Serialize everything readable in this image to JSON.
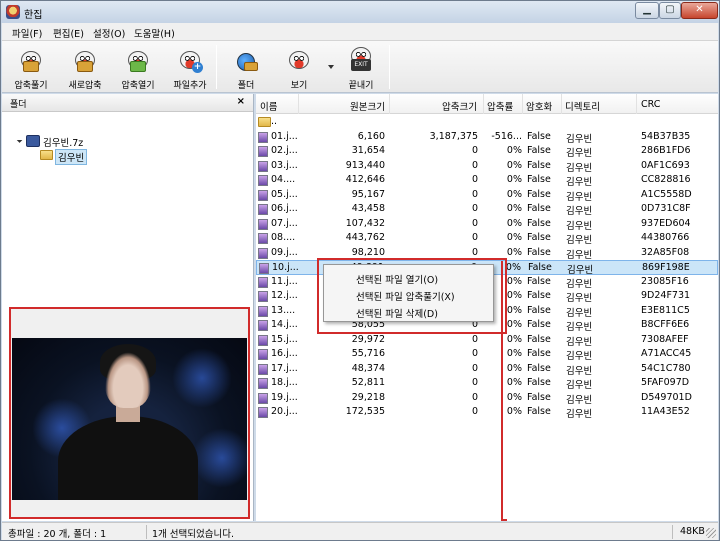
{
  "window": {
    "title": "한집"
  },
  "menu": [
    "파일(F)",
    "편집(E)",
    "설정(O)",
    "도움말(H)"
  ],
  "toolbar": [
    {
      "label": "압축풀기",
      "icon": "extract-icon"
    },
    {
      "label": "새로압축",
      "icon": "new-archive-icon"
    },
    {
      "label": "압축열기",
      "icon": "open-archive-icon"
    },
    {
      "label": "파일추가",
      "icon": "add-file-icon"
    },
    {
      "label": "폴더",
      "icon": "folder-view-icon"
    },
    {
      "label": "보기",
      "icon": "view-icon"
    },
    {
      "label": "끝내기",
      "icon": "exit-icon"
    }
  ],
  "folder_pane": {
    "title": "폴더",
    "close": "×",
    "archive": "김우빈.7z",
    "folder": "김우빈"
  },
  "columns": [
    "이름",
    "원본크기",
    "압축크기",
    "압축률",
    "암호화",
    "디렉토리",
    "CRC"
  ],
  "files": [
    {
      "name": "..",
      "orig": "",
      "comp": "",
      "ratio": "",
      "enc": "",
      "dir": "",
      "crc": "",
      "icon": "folder"
    },
    {
      "name": "01.j...",
      "orig": "6,160",
      "comp": "3,187,375",
      "ratio": "-516...",
      "enc": "False",
      "dir": "김우빈",
      "crc": "54B37B35",
      "icon": "img"
    },
    {
      "name": "02.j...",
      "orig": "31,654",
      "comp": "0",
      "ratio": "0%",
      "enc": "False",
      "dir": "김우빈",
      "crc": "286B1FD6",
      "icon": "img"
    },
    {
      "name": "03.j...",
      "orig": "913,440",
      "comp": "0",
      "ratio": "0%",
      "enc": "False",
      "dir": "김우빈",
      "crc": "0AF1C693",
      "icon": "img"
    },
    {
      "name": "04....",
      "orig": "412,646",
      "comp": "0",
      "ratio": "0%",
      "enc": "False",
      "dir": "김우빈",
      "crc": "CC828816",
      "icon": "img"
    },
    {
      "name": "05.j...",
      "orig": "95,167",
      "comp": "0",
      "ratio": "0%",
      "enc": "False",
      "dir": "김우빈",
      "crc": "A1C5558D",
      "icon": "img"
    },
    {
      "name": "06.j...",
      "orig": "43,458",
      "comp": "0",
      "ratio": "0%",
      "enc": "False",
      "dir": "김우빈",
      "crc": "0D731C8F",
      "icon": "img"
    },
    {
      "name": "07.j...",
      "orig": "107,432",
      "comp": "0",
      "ratio": "0%",
      "enc": "False",
      "dir": "김우빈",
      "crc": "937ED604",
      "icon": "img"
    },
    {
      "name": "08....",
      "orig": "443,762",
      "comp": "0",
      "ratio": "0%",
      "enc": "False",
      "dir": "김우빈",
      "crc": "44380766",
      "icon": "img"
    },
    {
      "name": "09.j...",
      "orig": "98,210",
      "comp": "0",
      "ratio": "0%",
      "enc": "False",
      "dir": "김우빈",
      "crc": "32A85F08",
      "icon": "img"
    },
    {
      "name": "10.j...",
      "orig": "49,891",
      "comp": "0",
      "ratio": "0%",
      "enc": "False",
      "dir": "김우빈",
      "crc": "869F198E",
      "icon": "img",
      "selected": true
    },
    {
      "name": "11.j...",
      "orig": "",
      "comp": "",
      "ratio": "0%",
      "enc": "False",
      "dir": "김우빈",
      "crc": "23085F16",
      "icon": "img"
    },
    {
      "name": "12.j...",
      "orig": "",
      "comp": "",
      "ratio": "0%",
      "enc": "False",
      "dir": "김우빈",
      "crc": "9D24F731",
      "icon": "img"
    },
    {
      "name": "13....",
      "orig": "",
      "comp": "",
      "ratio": "0%",
      "enc": "False",
      "dir": "김우빈",
      "crc": "E3E811C5",
      "icon": "img"
    },
    {
      "name": "14.j...",
      "orig": "58,055",
      "comp": "0",
      "ratio": "0%",
      "enc": "False",
      "dir": "김우빈",
      "crc": "B8CFF6E6",
      "icon": "img"
    },
    {
      "name": "15.j...",
      "orig": "29,972",
      "comp": "0",
      "ratio": "0%",
      "enc": "False",
      "dir": "김우빈",
      "crc": "7308AFEF",
      "icon": "img"
    },
    {
      "name": "16.j...",
      "orig": "55,716",
      "comp": "0",
      "ratio": "0%",
      "enc": "False",
      "dir": "김우빈",
      "crc": "A71ACC45",
      "icon": "img"
    },
    {
      "name": "17.j...",
      "orig": "48,374",
      "comp": "0",
      "ratio": "0%",
      "enc": "False",
      "dir": "김우빈",
      "crc": "54C1C780",
      "icon": "img"
    },
    {
      "name": "18.j...",
      "orig": "52,811",
      "comp": "0",
      "ratio": "0%",
      "enc": "False",
      "dir": "김우빈",
      "crc": "5FAF097D",
      "icon": "img"
    },
    {
      "name": "19.j...",
      "orig": "29,218",
      "comp": "0",
      "ratio": "0%",
      "enc": "False",
      "dir": "김우빈",
      "crc": "D549701D",
      "icon": "img"
    },
    {
      "name": "20.j...",
      "orig": "172,535",
      "comp": "0",
      "ratio": "0%",
      "enc": "False",
      "dir": "김우빈",
      "crc": "11A43E52",
      "icon": "img"
    }
  ],
  "context_menu": [
    "선택된 파일 열기(O)",
    "선택된 파일 압축풀기(X)",
    "선택된 파일 삭제(D)"
  ],
  "status": {
    "totals": "총파일 : 20 개, 폴더 : 1",
    "selection": "1개 선택되었습니다.",
    "size": "48KB"
  },
  "colors": {
    "highlight": "#d12b2b",
    "selection": "#cbe5f8"
  }
}
